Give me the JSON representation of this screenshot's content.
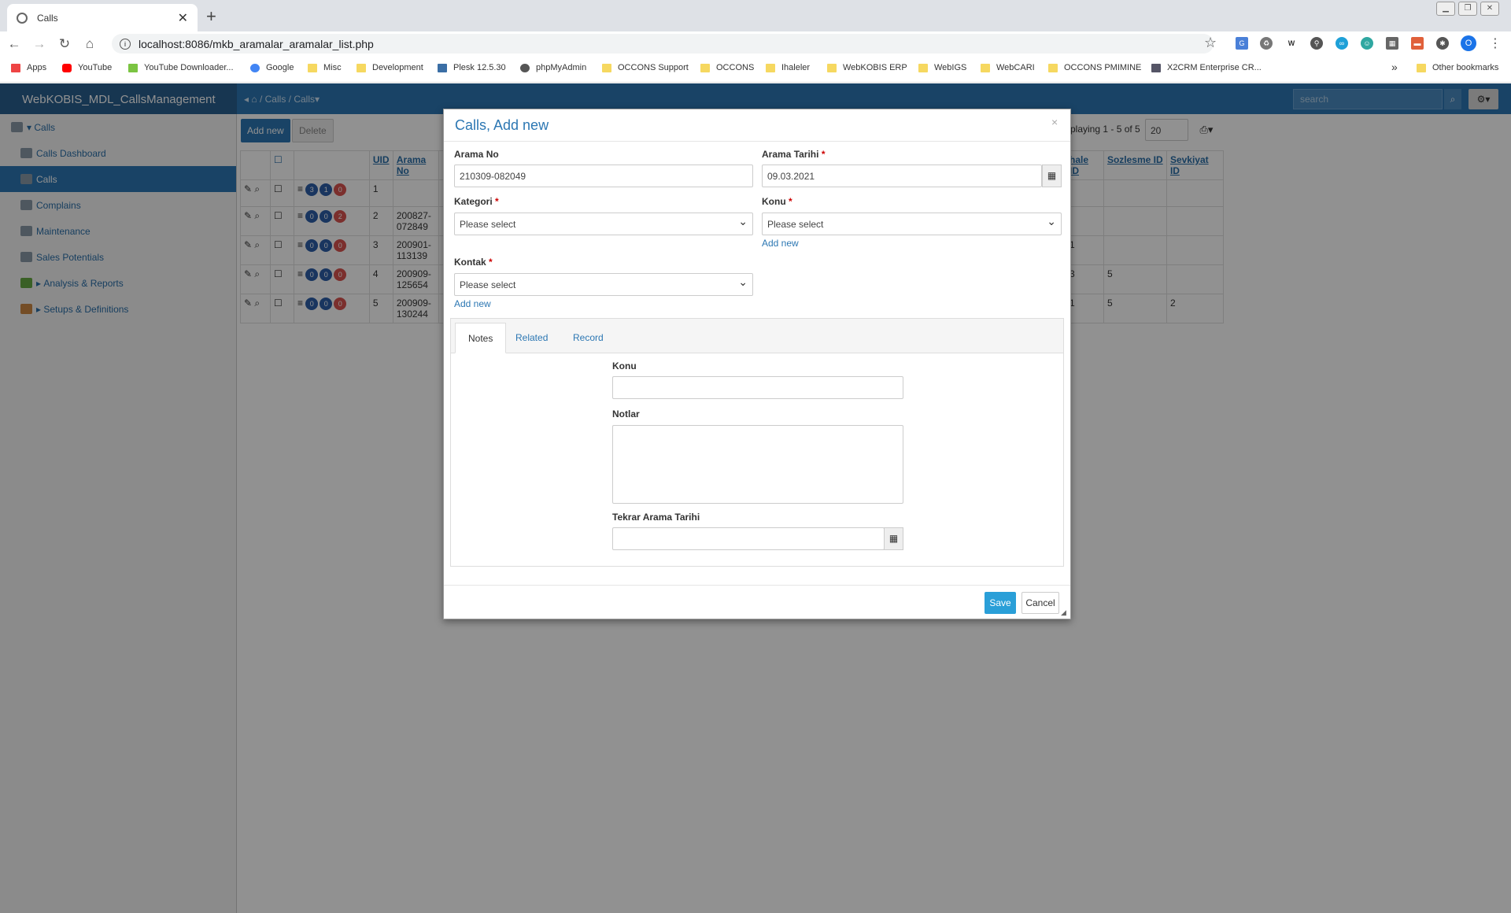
{
  "browser": {
    "tab_title": "Calls",
    "tab_close": "✕",
    "new_tab": "+",
    "url": "localhost:8086/mkb_aramalar_aramalar_list.php",
    "profile_initial": "O",
    "bookmarks": [
      "Apps",
      "YouTube",
      "YouTube Downloader...",
      "Google",
      "Misc",
      "Development",
      "Plesk 12.5.30",
      "phpMyAdmin",
      "OCCONS Support",
      "OCCONS",
      "Ihaleler",
      "WebKOBIS ERP",
      "WebIGS",
      "WebCARI",
      "OCCONS PMIMINE",
      "X2CRM Enterprise CR..."
    ],
    "overflow": "»",
    "other_bookmarks": "Other bookmarks"
  },
  "app": {
    "brand": "WebKOBIS_MDL_CallsManagement",
    "crumb_1": "Calls",
    "crumb_2": "Calls",
    "search_placeholder": "search"
  },
  "sidebar": {
    "items": [
      {
        "label": "Calls"
      },
      {
        "label": "Calls Dashboard"
      },
      {
        "label": "Calls"
      },
      {
        "label": "Complains"
      },
      {
        "label": "Maintenance"
      },
      {
        "label": "Sales Potentials"
      },
      {
        "label": "Analysis & Reports"
      },
      {
        "label": "Setups & Definitions"
      }
    ]
  },
  "toolbar": {
    "add_new": "Add new",
    "delete": "Delete",
    "displaying": "playing 1 - 5 of 5",
    "page_size": "20"
  },
  "grid": {
    "headers": [
      "UID",
      "Arama No",
      "hale ID",
      "Sozlesme ID",
      "Sevkiyat ID"
    ],
    "rows": [
      {
        "uid": "1",
        "no": "",
        "b1": "3",
        "b2": "1",
        "b3": "0",
        "ihale": "",
        "soz": "",
        "sev": ""
      },
      {
        "uid": "2",
        "no": "200827-072849",
        "b1": "0",
        "b2": "0",
        "b3": "2",
        "ihale": "",
        "soz": "",
        "sev": ""
      },
      {
        "uid": "3",
        "no": "200901-113139",
        "b1": "0",
        "b2": "0",
        "b3": "0",
        "ihale": "1",
        "soz": "",
        "sev": ""
      },
      {
        "uid": "4",
        "no": "200909-125654",
        "b1": "0",
        "b2": "0",
        "b3": "0",
        "ihale": "3",
        "soz": "5",
        "sev": ""
      },
      {
        "uid": "5",
        "no": "200909-130244",
        "b1": "0",
        "b2": "0",
        "b3": "0",
        "ihale": "1",
        "soz": "5",
        "sev": "2"
      }
    ]
  },
  "modal": {
    "title": "Calls, Add new",
    "close": "×",
    "arama_no_label": "Arama No",
    "arama_no_value": "210309-082049",
    "arama_tarihi_label": "Arama Tarihi",
    "arama_tarihi_value": "09.03.2021",
    "kategori_label": "Kategori",
    "kategori_value": "Please select",
    "konu_label": "Konu",
    "konu_value": "Please select",
    "konu_add_new": "Add new",
    "kontak_label": "Kontak",
    "kontak_value": "Please select",
    "kontak_add_new": "Add new",
    "required_mark": "*",
    "tabs": [
      "Notes",
      "Related",
      "Record"
    ],
    "notes_konu_label": "Konu",
    "notlar_label": "Notlar",
    "tekrar_label": "Tekrar Arama Tarihi",
    "save": "Save",
    "cancel": "Cancel"
  }
}
